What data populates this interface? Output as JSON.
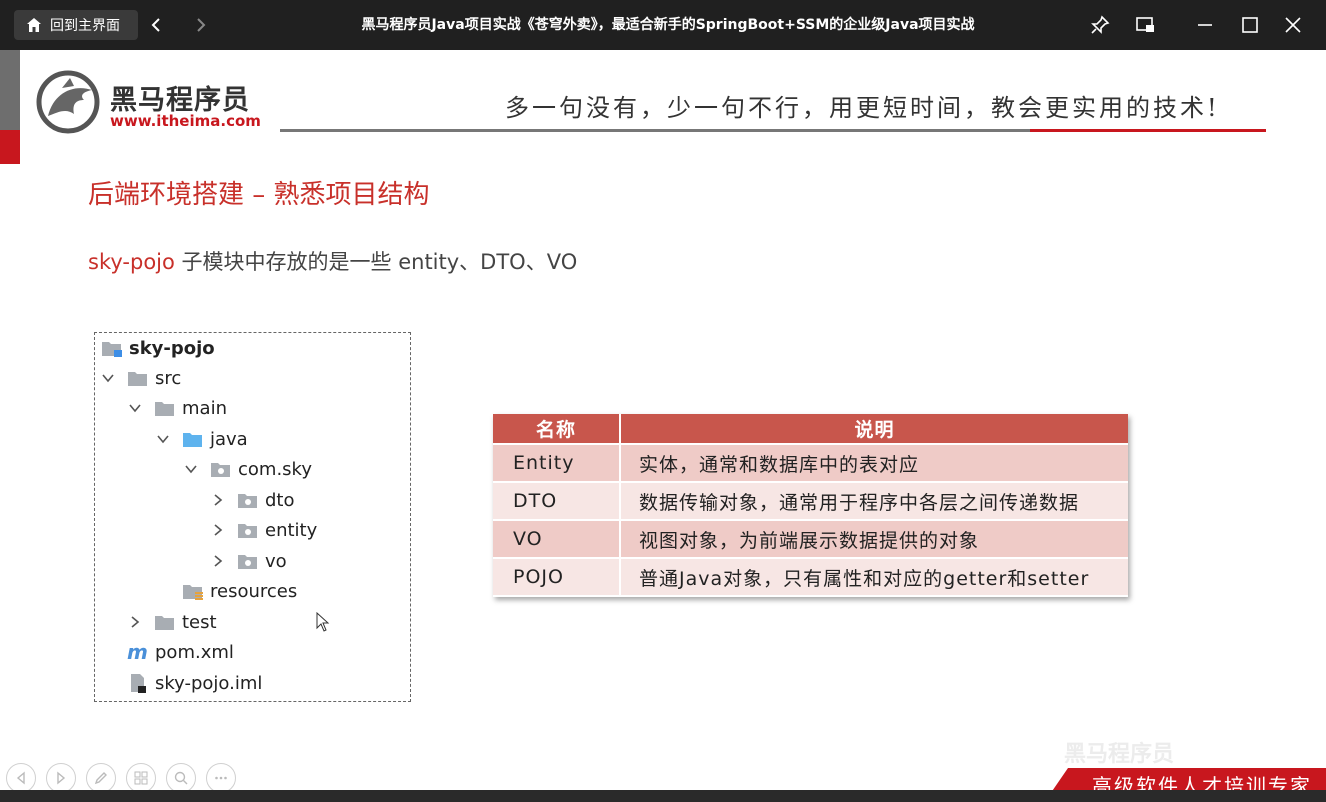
{
  "window": {
    "home_label": "回到主界面",
    "title": "黑马程序员Java项目实战《苍穹外卖》，最适合新手的SpringBoot+SSM的企业级Java项目实战"
  },
  "slide": {
    "brand_name": "黑马程序员",
    "brand_url": "www.itheima.com",
    "slogan": "多一句没有，少一句不行，用更短时间，教会更实用的技术!",
    "section_title": "后端环境搭建 – 熟悉项目结构",
    "desc_highlight": "sky-pojo",
    "desc_text": " 子模块中存放的是一些 entity、DTO、VO",
    "tree": [
      {
        "label": "sky-pojo",
        "icon": "module-folder-icon",
        "chevron": "none",
        "bold": true
      },
      {
        "label": "src",
        "icon": "folder-icon",
        "chevron": "down"
      },
      {
        "label": "main",
        "icon": "folder-icon",
        "chevron": "down"
      },
      {
        "label": "java",
        "icon": "source-folder-icon",
        "chevron": "down"
      },
      {
        "label": "com.sky",
        "icon": "package-icon",
        "chevron": "down"
      },
      {
        "label": "dto",
        "icon": "package-icon",
        "chevron": "right"
      },
      {
        "label": "entity",
        "icon": "package-icon",
        "chevron": "right"
      },
      {
        "label": "vo",
        "icon": "package-icon",
        "chevron": "right"
      },
      {
        "label": "resources",
        "icon": "resources-folder-icon",
        "chevron": "none"
      },
      {
        "label": "test",
        "icon": "folder-icon",
        "chevron": "right"
      },
      {
        "label": "pom.xml",
        "icon": "maven-icon",
        "chevron": "none"
      },
      {
        "label": "sky-pojo.iml",
        "icon": "iml-file-icon",
        "chevron": "none"
      }
    ],
    "table": {
      "headers": [
        "名称",
        "说明"
      ],
      "rows": [
        [
          "Entity",
          "实体，通常和数据库中的表对应"
        ],
        [
          "DTO",
          "数据传输对象，通常用于程序中各层之间传递数据"
        ],
        [
          "VO",
          "视图对象，为前端展示数据提供的对象"
        ],
        [
          "POJO",
          "普通Java对象，只有属性和对应的getter和setter"
        ]
      ]
    },
    "banner_text": "高级软件人才培训专家",
    "watermark_text": "黑马程序员"
  },
  "colors": {
    "accent_red": "#c8171e",
    "title_red": "#c8302a",
    "table_header": "#c8564c",
    "table_row_odd": "#efcbc7",
    "table_row_even": "#f7e6e4"
  }
}
